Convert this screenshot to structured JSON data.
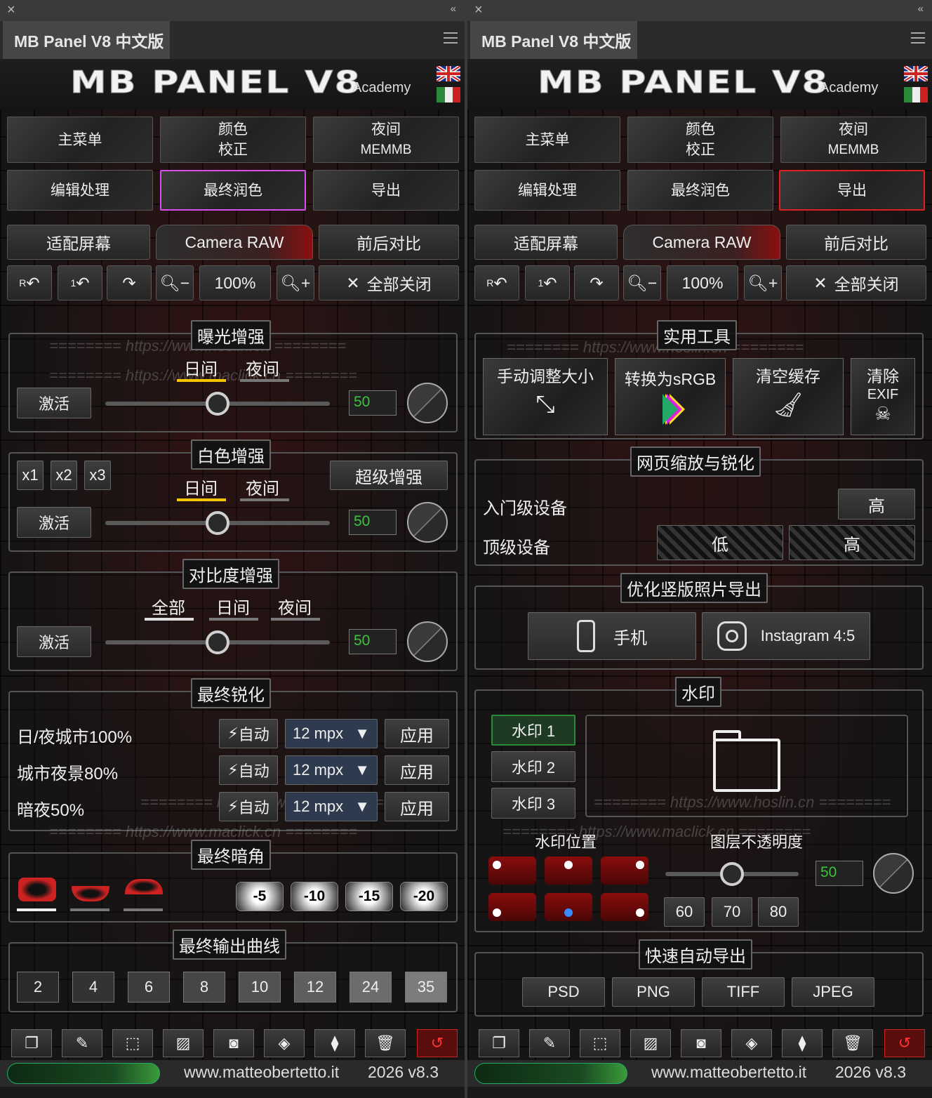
{
  "left": {
    "titlebar": {
      "close_icon": "×",
      "collapse_icon": "«"
    },
    "tab": "MB Panel V8 中文版",
    "logo": "MB PANEL V8",
    "academy": "Academy",
    "menu": [
      {
        "l1": "主菜单",
        "l2": ""
      },
      {
        "l1": "颜色",
        "l2": "校正"
      },
      {
        "l1": "夜间",
        "l2": "MEMMB"
      },
      {
        "l1": "编辑处理",
        "l2": ""
      },
      {
        "l1": "最终润色",
        "l2": ""
      },
      {
        "l1": "导出",
        "l2": ""
      }
    ],
    "tools": {
      "fit": "适配屏幕",
      "camera": "Camera RAW",
      "compare": "前后对比",
      "zoom": "100%",
      "closeall": "全部关闭",
      "undo_r": "R",
      "undo_1": "1"
    },
    "exposure": {
      "title": "曝光增强",
      "day": "日间",
      "night": "夜间",
      "activate": "激活",
      "value": "50",
      "slider": 0.5
    },
    "white": {
      "title": "白色增强",
      "day": "日间",
      "night": "夜间",
      "activate": "激活",
      "value": "50",
      "x1": "x1",
      "x2": "x2",
      "x3": "x3",
      "super": "超级增强",
      "slider": 0.5
    },
    "contrast": {
      "title": "对比度增强",
      "all": "全部",
      "day": "日间",
      "night": "夜间",
      "activate": "激活",
      "value": "50",
      "slider": 0.5
    },
    "sharpen": {
      "title": "最终锐化",
      "rows": [
        {
          "label": "日/夜城市100%",
          "auto": "自动",
          "mpx": "12 mpx",
          "apply": "应用"
        },
        {
          "label": "城市夜景80%",
          "auto": "自动",
          "mpx": "12 mpx",
          "apply": "应用"
        },
        {
          "label": "暗夜50%",
          "auto": "自动",
          "mpx": "12 mpx",
          "apply": "应用"
        }
      ]
    },
    "vignette": {
      "title": "最终暗角",
      "values": [
        "-5",
        "-10",
        "-15",
        "-20"
      ]
    },
    "curve": {
      "title": "最终输出曲线",
      "values": [
        "2",
        "4",
        "6",
        "8",
        "10",
        "12",
        "24",
        "35"
      ]
    },
    "watermark_text": [
      "======== https://www.hoslin.cn ========",
      "======== https://www.maclick.cn ========"
    ],
    "footer": {
      "url": "www.matteobertetto.it",
      "version": "2026 v8.3"
    }
  },
  "right": {
    "tab": "MB Panel V8 中文版",
    "logo": "MB PANEL V8",
    "academy": "Academy",
    "menu": [
      {
        "l1": "主菜单",
        "l2": ""
      },
      {
        "l1": "颜色",
        "l2": "校正"
      },
      {
        "l1": "夜间",
        "l2": "MEMMB"
      },
      {
        "l1": "编辑处理",
        "l2": ""
      },
      {
        "l1": "最终润色",
        "l2": ""
      },
      {
        "l1": "导出",
        "l2": ""
      }
    ],
    "tools": {
      "fit": "适配屏幕",
      "camera": "Camera RAW",
      "compare": "前后对比",
      "zoom": "100%",
      "closeall": "全部关闭",
      "undo_r": "R",
      "undo_1": "1"
    },
    "utility": {
      "title": "实用工具",
      "resize": "手动调整大小",
      "srgb": "转换为sRGB",
      "cache": "清空缓存",
      "exif1": "清除",
      "exif2": "EXIF"
    },
    "web": {
      "title": "网页缩放与锐化",
      "entry": "入门级设备",
      "top": "顶级设备",
      "high1": "高",
      "low": "低",
      "high2": "高"
    },
    "vertical": {
      "title": "优化竖版照片导出",
      "phone": "手机",
      "instagram": "Instagram 4:5"
    },
    "watermark": {
      "title": "水印",
      "w1": "水印 1",
      "w2": "水印 2",
      "w3": "水印 3",
      "position": "水印位置",
      "opacity": "图层不透明度",
      "value": "50",
      "o60": "60",
      "o70": "70",
      "o80": "80",
      "slider": 0.5
    },
    "quick": {
      "title": "快速自动导出",
      "psd": "PSD",
      "png": "PNG",
      "tiff": "TIFF",
      "jpeg": "JPEG"
    },
    "watermark_text": [
      "======== https://www.hoslin.cn ========",
      "======== https://www.maclick.cn ========"
    ],
    "footer": {
      "url": "www.matteobertetto.it",
      "version": "2026 v8.3"
    }
  },
  "colors": {
    "accent_yellow": "#f5c400",
    "pink_border": "#d84ee8",
    "red_border": "#e02020",
    "green_value": "#3ec23e"
  }
}
